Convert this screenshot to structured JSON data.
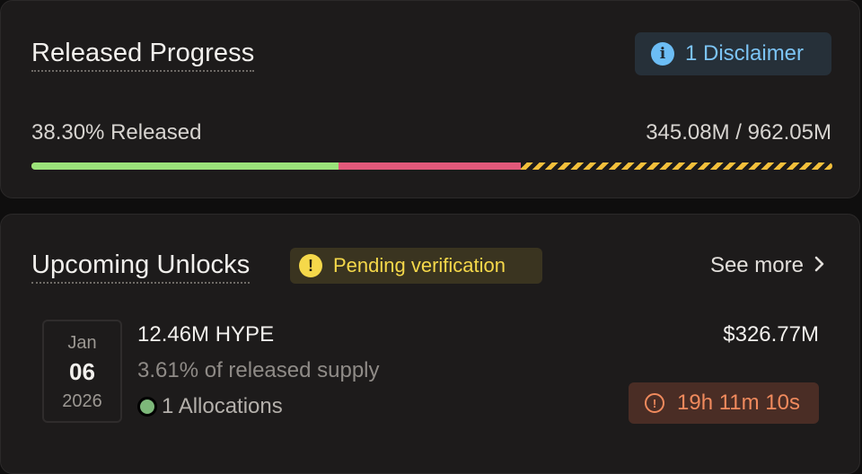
{
  "released_progress": {
    "title": "Released Progress",
    "disclaimer_icon": "info-icon",
    "disclaimer_label": "1 Disclaimer",
    "released_text": "38.30% Released",
    "supply_text": "345.08M / 962.05M",
    "progress": {
      "released_fraction": 0.383,
      "second_segment_fraction": 0.228,
      "colors": {
        "released": "#9be37a",
        "second_segment": "#e2597a",
        "remaining_stripe": "#f2bf3b"
      }
    }
  },
  "upcoming_unlocks": {
    "title": "Upcoming Unlocks",
    "pending_icon": "warning-icon",
    "pending_label": "Pending verification",
    "see_more_label": "See more",
    "see_more_icon": "chevron-right-icon",
    "unlock": {
      "month": "Jan",
      "day": "06",
      "year": "2026",
      "amount": "12.46M HYPE",
      "supply_percent": "3.61% of released supply",
      "allocations": "1 Allocations",
      "allocation_color": "#7db87a",
      "usd_value": "$326.77M",
      "countdown_icon": "clock-alert-icon",
      "countdown": "19h 11m 10s"
    }
  }
}
